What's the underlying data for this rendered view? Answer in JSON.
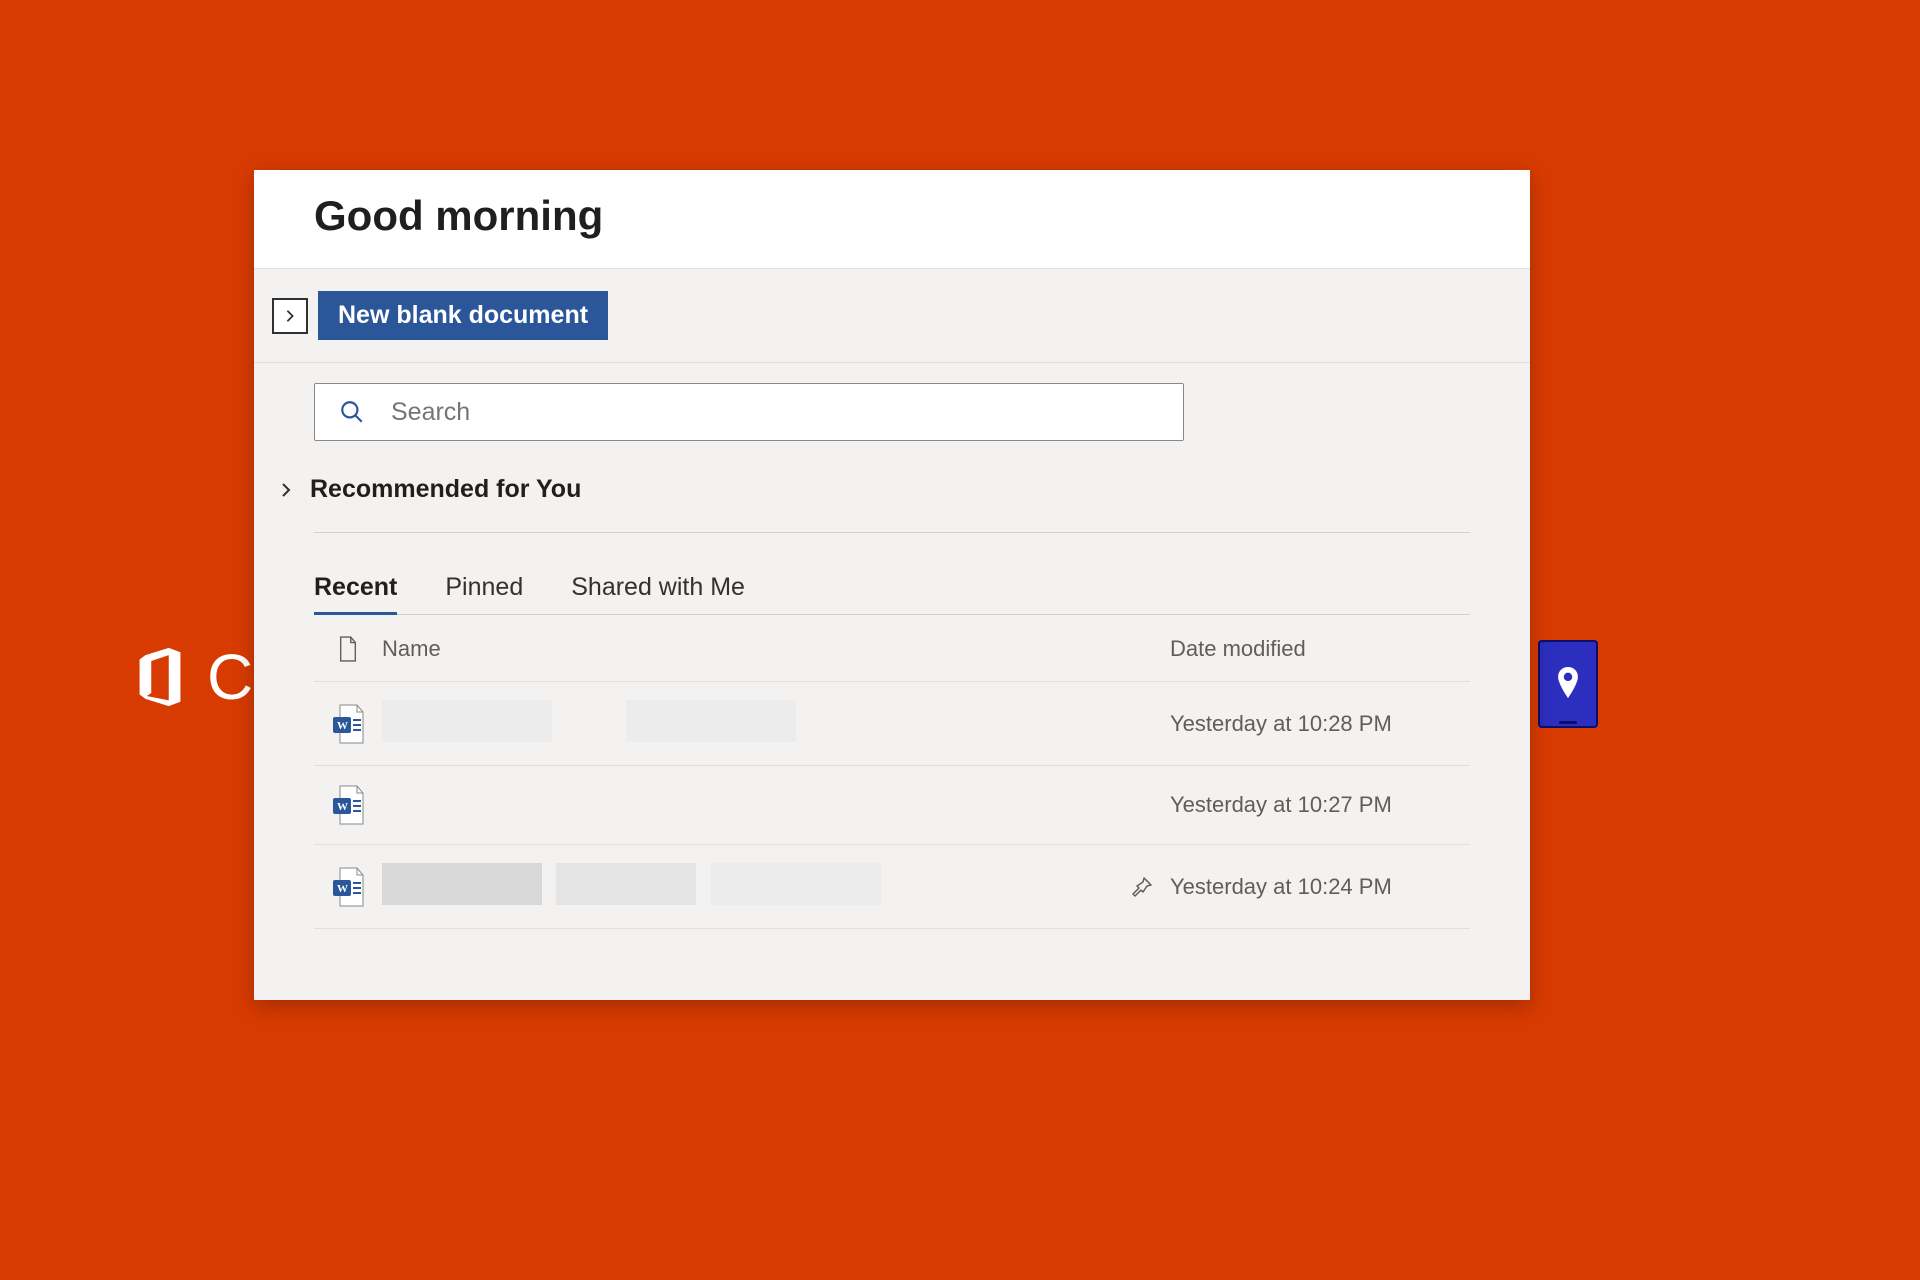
{
  "greeting": "Good morning",
  "new_blank_label": "New blank document",
  "search": {
    "placeholder": "Search"
  },
  "recommended_label": "Recommended for You",
  "tabs": {
    "recent": "Recent",
    "pinned": "Pinned",
    "shared": "Shared with Me"
  },
  "columns": {
    "name": "Name",
    "date": "Date modified"
  },
  "documents": [
    {
      "date_modified": "Yesterday at 10:28 PM",
      "pinned": false
    },
    {
      "date_modified": "Yesterday at 10:27 PM",
      "pinned": false
    },
    {
      "date_modified": "Yesterday at 10:24 PM",
      "pinned": true
    }
  ],
  "background_logo_text": "C"
}
